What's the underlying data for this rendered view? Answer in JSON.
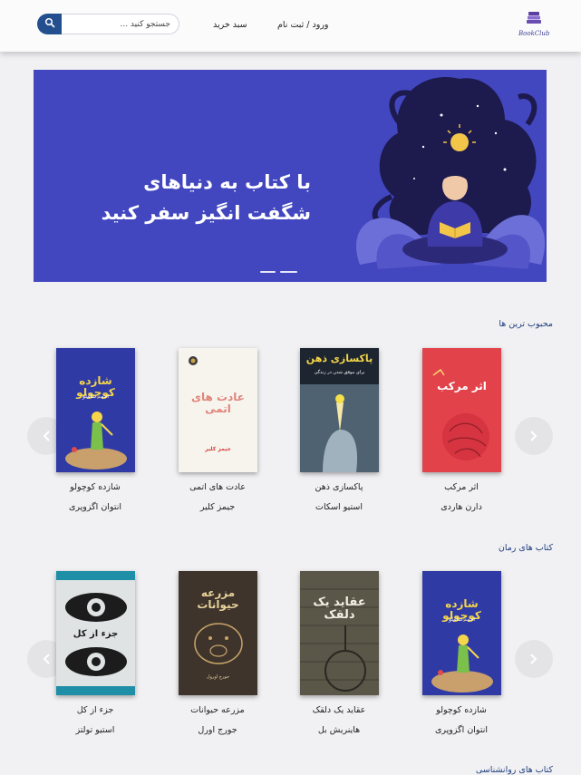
{
  "header": {
    "logo_text": "BookClub",
    "login_label": "ورود / ثبت نام",
    "cart_label": "سبد خرید",
    "search_placeholder": "جستجو کنید ..."
  },
  "banner": {
    "line1": "با کتاب به دنیاهای",
    "line2": "شگفت انگیز سفر کنید",
    "accent": "#4247c0"
  },
  "sections": [
    {
      "title": "محبوب ترین ها",
      "books": [
        {
          "title": "اثر مرکب",
          "author": "دارن هاردی",
          "cover_title": "اثر مرکب",
          "cover_color": "#e2434b"
        },
        {
          "title": "پاکسازی ذهن",
          "author": "استیو اسکات",
          "cover_title": "پاکسازی ذهن",
          "cover_sub": "برای موفق شدن در زندگی",
          "cover_color": "#4e6272"
        },
        {
          "title": "عادت های اتمی",
          "author": "جیمز کلیر",
          "cover_title": "عادت های اتمی",
          "cover_sub": "جیمز کلیر",
          "cover_color": "#f7f4ee"
        },
        {
          "title": "شازده کوچولو",
          "author": "انتوان اگزوپری",
          "cover_title": "شازده کوچولو",
          "cover_sub": "احمد شاملو",
          "cover_color": "#2f3aa5"
        }
      ]
    },
    {
      "title": "کتاب های رمان",
      "books": [
        {
          "title": "شازده کوچولو",
          "author": "انتوان اگزوپری",
          "cover_title": "شازده کوچولو",
          "cover_sub": "احمد شاملو",
          "cover_color": "#2f3aa5"
        },
        {
          "title": "عقاید یک دلقک",
          "author": "هاینریش بل",
          "cover_title": "عقاید یک دلقک",
          "cover_color": "#5a5648"
        },
        {
          "title": "مزرعه حیوانات",
          "author": "جورج اورل",
          "cover_title": "مزرعه حیوانات",
          "cover_sub": "جورج اورول",
          "cover_color": "#3e342c"
        },
        {
          "title": "جزء از کل",
          "author": "استیو تولتز",
          "cover_title": "جزء از کل",
          "cover_color": "#1f8fa7"
        }
      ]
    },
    {
      "title": "کتاب های روانشناسی",
      "books": []
    }
  ]
}
